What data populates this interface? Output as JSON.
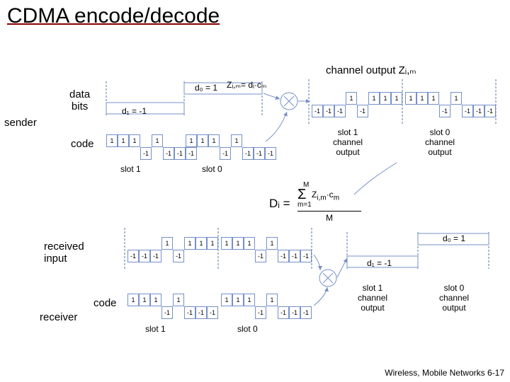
{
  "title": "CDMA encode/decode",
  "labels": {
    "data_bits": "data\nbits",
    "sender": "sender",
    "code": "code",
    "slot1": "slot 1",
    "slot0": "slot 0",
    "d1": "d₁ = -1",
    "d0": "d₀ = 1",
    "zim_eq": "Zᵢ,ₘ= dᵢ·cₘ",
    "channel_out": "channel output Zᵢ,ₘ",
    "s1_out": "slot 1\nchannel\noutput",
    "s0_out": "slot 0\nchannel\noutput",
    "di_eq": "Dᵢ =",
    "sigma_top": "M",
    "sigma_bot": "m=1",
    "sigma_body": "Σ Zᵢ,ₘ·cₘ",
    "M_divider": "M",
    "received": "received\ninput",
    "receiver": "receiver"
  },
  "chips": {
    "code_s1_top": [
      "1",
      "1",
      "1",
      ""
    ],
    "code_s1_bot": [
      "",
      "",
      "",
      "-1",
      "-1",
      "-1",
      "-1"
    ],
    "code_s0_top": [
      "1",
      "1",
      "1",
      ""
    ],
    "code_s0_bot": [
      "",
      "",
      "",
      "-1",
      "-1",
      "-1",
      "-1"
    ],
    "out_s1_top": [
      "",
      "",
      "",
      "1",
      "1",
      "1",
      "1"
    ],
    "out_s1_bot": [
      "-1",
      "-1",
      "-1",
      ""
    ],
    "out_s0_top": [
      "1",
      "1",
      "1",
      ""
    ],
    "out_s0_bot": [
      "",
      "",
      "",
      "-1",
      "-1",
      "-1",
      "-1"
    ],
    "recv_s1_top": [
      "",
      "",
      "",
      "1",
      "1",
      "1",
      "1"
    ],
    "recv_s1_bot": [
      "-1",
      "-1",
      "-1",
      ""
    ],
    "recv_s0_top": [
      "1",
      "1",
      "1",
      ""
    ],
    "recv_s0_bot": [
      "",
      "",
      "",
      "-1",
      "-1",
      "-1",
      "-1"
    ]
  },
  "footer": "Wireless, Mobile Networks  6-17",
  "chart_data": {
    "type": "table",
    "title": "CDMA spreading-code example",
    "code_sequence": [
      1,
      1,
      1,
      -1,
      1,
      -1,
      -1,
      -1
    ],
    "data_bits": {
      "d1": -1,
      "d0": 1
    },
    "encoded_slot1": [
      -1,
      -1,
      -1,
      1,
      -1,
      1,
      1,
      1
    ],
    "encoded_slot0": [
      1,
      1,
      1,
      -1,
      1,
      -1,
      -1,
      -1
    ],
    "channel_output": [
      -1,
      -1,
      -1,
      1,
      -1,
      1,
      1,
      1,
      1,
      1,
      1,
      -1,
      1,
      -1,
      -1,
      -1
    ],
    "received_input": [
      -1,
      -1,
      -1,
      1,
      -1,
      1,
      1,
      1,
      1,
      1,
      1,
      -1,
      1,
      -1,
      -1,
      -1
    ],
    "decode_formula": "D_i = (1/M) * sum_{m=1..M} Z_{i,m} * c_m",
    "M": 8
  }
}
